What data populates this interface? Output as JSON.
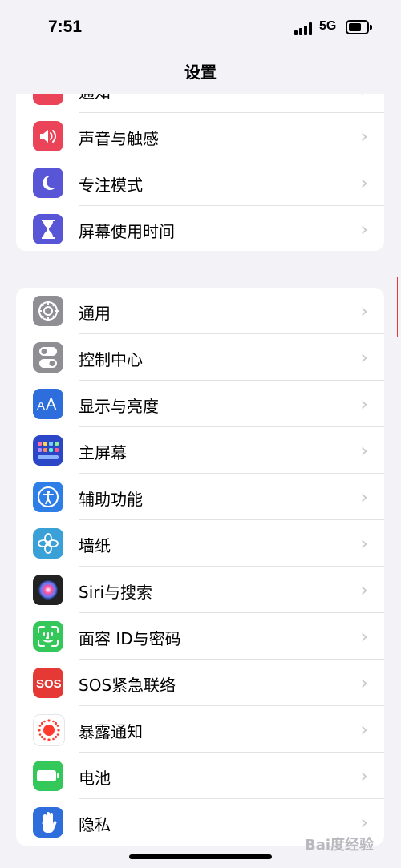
{
  "status_bar": {
    "time": "7:51",
    "network": "5G"
  },
  "nav": {
    "title": "设置"
  },
  "partial_top": {
    "label": "通知"
  },
  "group1": [
    {
      "label": "声音与触感",
      "icon": "sound-icon",
      "color": "#eb4459"
    },
    {
      "label": "专注模式",
      "icon": "focus-moon-icon",
      "color": "#5856d6"
    },
    {
      "label": "屏幕使用时间",
      "icon": "hourglass-icon",
      "color": "#5856d6"
    }
  ],
  "group2": [
    {
      "label": "通用",
      "icon": "gear-icon",
      "color": "#8e8e93"
    },
    {
      "label": "控制中心",
      "icon": "toggle-icon",
      "color": "#8e8e93"
    },
    {
      "label": "显示与亮度",
      "icon": "text-size-icon",
      "color": "#2e6edc"
    },
    {
      "label": "主屏幕",
      "icon": "home-grid-icon",
      "color": "#2c46c8"
    },
    {
      "label": "辅助功能",
      "icon": "accessibility-icon",
      "color": "#2e7ee8"
    },
    {
      "label": "墙纸",
      "icon": "flower-icon",
      "color": "#3aa0d8"
    },
    {
      "label": "Siri与搜索",
      "icon": "siri-icon",
      "color": "#222222"
    },
    {
      "label": "面容 ID与密码",
      "icon": "face-id-icon",
      "color": "#34c759"
    },
    {
      "label": "SOS紧急联络",
      "icon": "sos-icon",
      "color": "#e53935"
    },
    {
      "label": "暴露通知",
      "icon": "exposure-icon",
      "color": "#ffffff"
    },
    {
      "label": "电池",
      "icon": "battery-icon",
      "color": "#34c759"
    },
    {
      "label": "隐私",
      "icon": "hand-icon",
      "color": "#2e6edc"
    }
  ],
  "watermark": "Bai度经验"
}
